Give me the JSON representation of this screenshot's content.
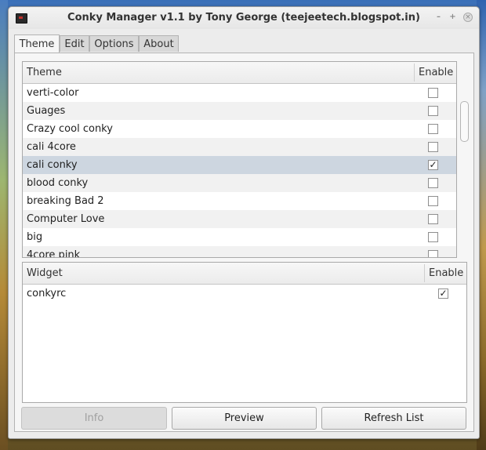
{
  "window": {
    "title": "Conky Manager v1.1 by Tony George (teejeetech.blogspot.in)",
    "minimize_glyph": "–",
    "maximize_glyph": "+",
    "close_glyph": "×"
  },
  "tabs": [
    {
      "label": "Theme",
      "active": true
    },
    {
      "label": "Edit",
      "active": false
    },
    {
      "label": "Options",
      "active": false
    },
    {
      "label": "About",
      "active": false
    }
  ],
  "theme_list": {
    "headers": {
      "name": "Theme",
      "enable": "Enable"
    },
    "rows": [
      {
        "name": "verti-color",
        "enabled": false,
        "selected": false
      },
      {
        "name": "Guages",
        "enabled": false,
        "selected": false
      },
      {
        "name": "Crazy cool conky",
        "enabled": false,
        "selected": false
      },
      {
        "name": "cali 4core",
        "enabled": false,
        "selected": false
      },
      {
        "name": "cali conky",
        "enabled": true,
        "selected": true
      },
      {
        "name": "blood conky",
        "enabled": false,
        "selected": false
      },
      {
        "name": "breaking Bad 2",
        "enabled": false,
        "selected": false
      },
      {
        "name": "Computer Love",
        "enabled": false,
        "selected": false
      },
      {
        "name": "big",
        "enabled": false,
        "selected": false
      },
      {
        "name": "4core pink",
        "enabled": false,
        "selected": false
      }
    ]
  },
  "widget_list": {
    "headers": {
      "name": "Widget",
      "enable": "Enable"
    },
    "rows": [
      {
        "name": "conkyrc",
        "enabled": true
      }
    ]
  },
  "buttons": {
    "info": "Info",
    "preview": "Preview",
    "refresh": "Refresh List"
  },
  "check_glyph": "✓"
}
